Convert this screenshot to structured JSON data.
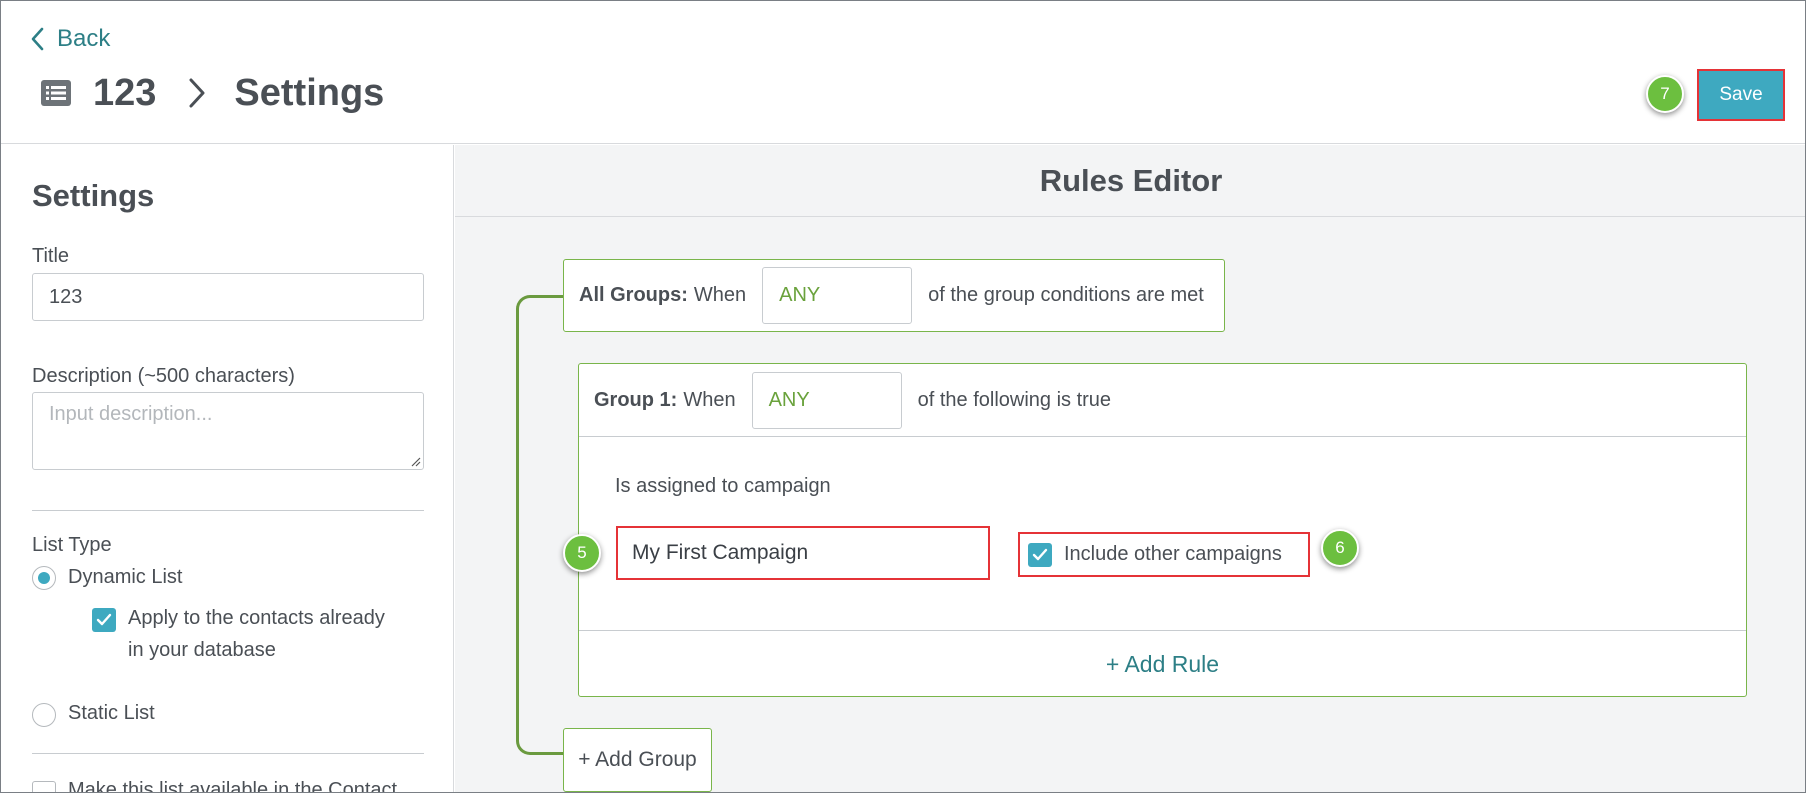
{
  "header": {
    "back_label": "Back",
    "breadcrumb_id": "123",
    "breadcrumb_title": "Settings",
    "save_label": "Save",
    "save_marker": "7"
  },
  "settings": {
    "heading": "Settings",
    "title_label": "Title",
    "title_value": "123",
    "description_label": "Description (~500 characters)",
    "description_placeholder": "Input description...",
    "list_type_label": "List Type",
    "dynamic_list_label": "Dynamic List",
    "dynamic_list_selected": true,
    "apply_label_line1": "Apply to the contacts already",
    "apply_label_line2": "in your database",
    "apply_checked": true,
    "static_list_label": "Static List",
    "static_list_selected": false,
    "available_label": "Make this list available in the Contact",
    "available_checked": false
  },
  "rules_editor": {
    "heading": "Rules Editor",
    "all_groups": {
      "label": "All Groups:",
      "when": "When",
      "condition": "ANY",
      "suffix": "of the group conditions are met"
    },
    "groups": [
      {
        "label": "Group 1:",
        "when": "When",
        "condition": "ANY",
        "suffix": "of the following is true",
        "rule_label": "Is assigned to campaign",
        "campaign_value": "My First Campaign",
        "campaign_marker": "5",
        "include_label": "Include other campaigns",
        "include_checked": true,
        "include_marker": "6",
        "add_rule_label": "+ Add Rule"
      }
    ],
    "add_group_label": "+ Add Group"
  },
  "colors": {
    "accent": "#3ea9c0",
    "link": "#2d7f86",
    "group_border": "#79b54a",
    "condition_text": "#6aa23c",
    "highlight": "#e53337",
    "marker": "#6cbf3f"
  }
}
